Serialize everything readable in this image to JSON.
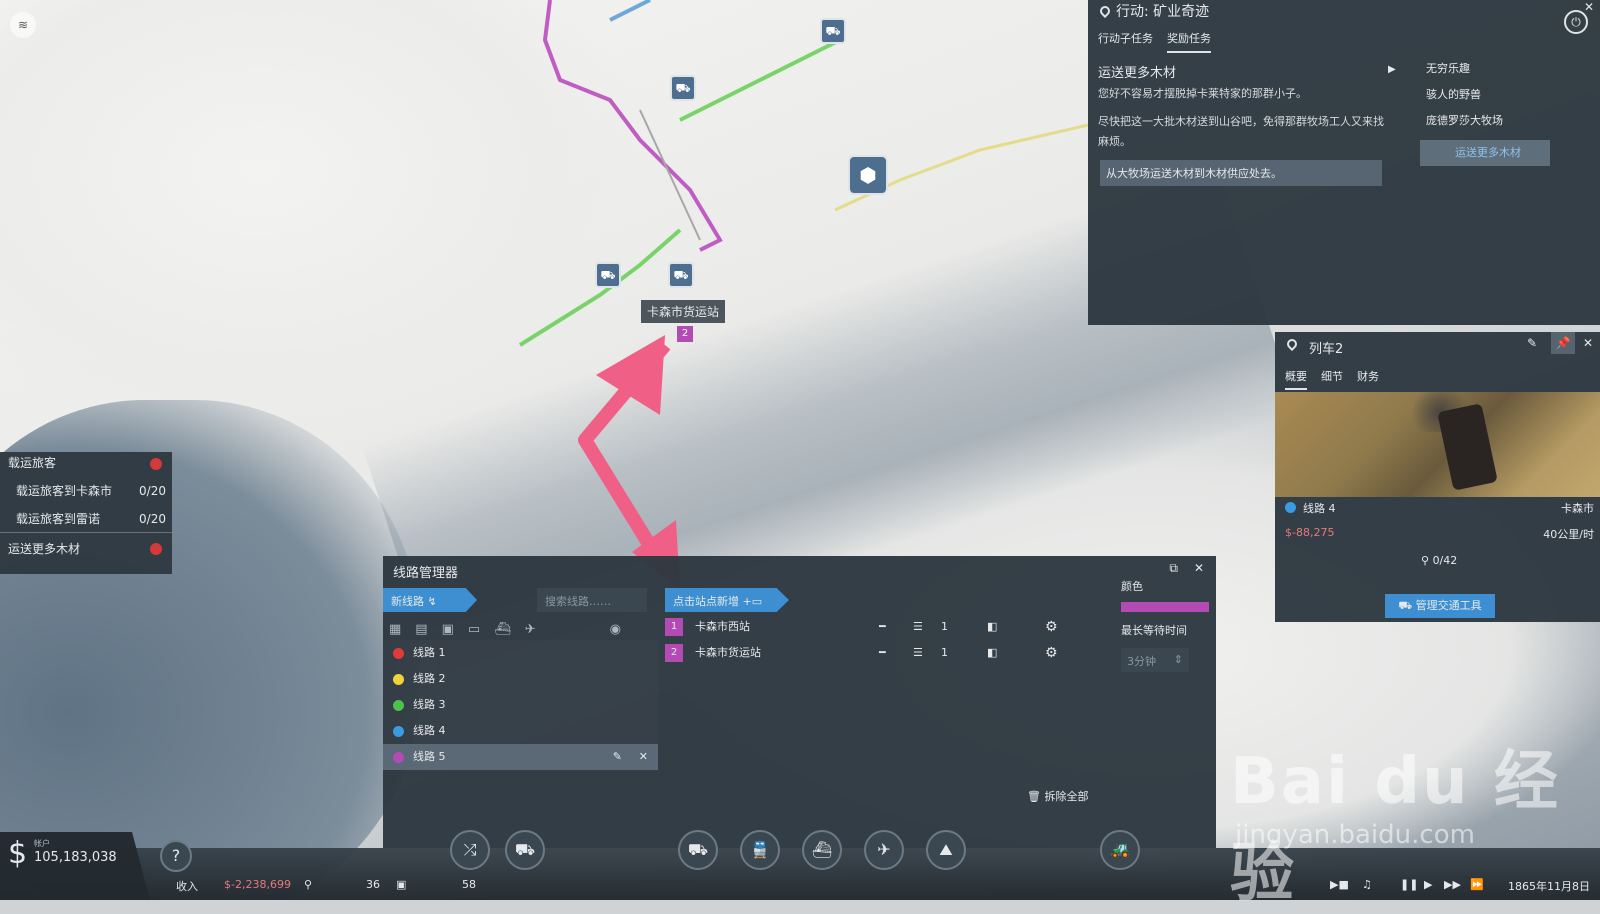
{
  "quest": {
    "title": "行动: 矿业奇迹",
    "tabs": [
      "行动子任务",
      "奖励任务"
    ],
    "task_title": "运送更多木材",
    "desc1": "您好不容易才摆脱掉卡莱特家的那群小子。",
    "desc2": "尽快把这一大批木材送到山谷吧，免得那群牧场工人又来找麻烦。",
    "objective": "从大牧场运送木材到木材供应处去。",
    "list": [
      "无穷乐趣",
      "骇人的野兽",
      "庞德罗莎大牧场",
      "运送更多木材"
    ]
  },
  "train_panel": {
    "title": "列车2",
    "tabs": [
      "概要",
      "细节",
      "财务"
    ],
    "line": "线路 4",
    "destination": "卡森市",
    "cost": "$-88,275",
    "speed": "40公里/时",
    "passengers": "0/42",
    "manage_label": "管理交通工具"
  },
  "mini_panel": {
    "title": "载运旅客",
    "sub": [
      {
        "label": "载运旅客到卡森市",
        "value": "0/20"
      },
      {
        "label": "载运旅客到雷诺",
        "value": "0/20"
      }
    ],
    "task2": "运送更多木材"
  },
  "map": {
    "station_label": "卡森市货运站",
    "station_number": "2"
  },
  "line_manager": {
    "title": "线路管理器",
    "new_line_label": "新线路",
    "search_placeholder": "搜索线路……",
    "add_stop_label": "点击站点新增",
    "lines": [
      {
        "name": "线路 1",
        "color": "#e03a3a"
      },
      {
        "name": "线路 2",
        "color": "#f0d23a"
      },
      {
        "name": "线路 3",
        "color": "#4cc24c"
      },
      {
        "name": "线路 4",
        "color": "#3a9be0"
      },
      {
        "name": "线路 5",
        "color": "#b34bb5"
      }
    ],
    "stops": [
      {
        "num": "1",
        "name": "卡森市西站",
        "count": "1"
      },
      {
        "num": "2",
        "name": "卡森市货运站",
        "count": "1"
      }
    ],
    "color_label": "颜色",
    "wait_label": "最长等待时间",
    "wait_value": "3分钟",
    "remove_all_label": "拆除全部"
  },
  "bottom_bar": {
    "account_label": "帐户",
    "money": "105,183,038",
    "income_label": "收入",
    "income_value": "$-2,238,699",
    "people": "36",
    "cargo": "58",
    "date": "1865年11月8日"
  },
  "watermark": {
    "main": "Bai du 经验",
    "url": "jingyan.baidu.com"
  }
}
